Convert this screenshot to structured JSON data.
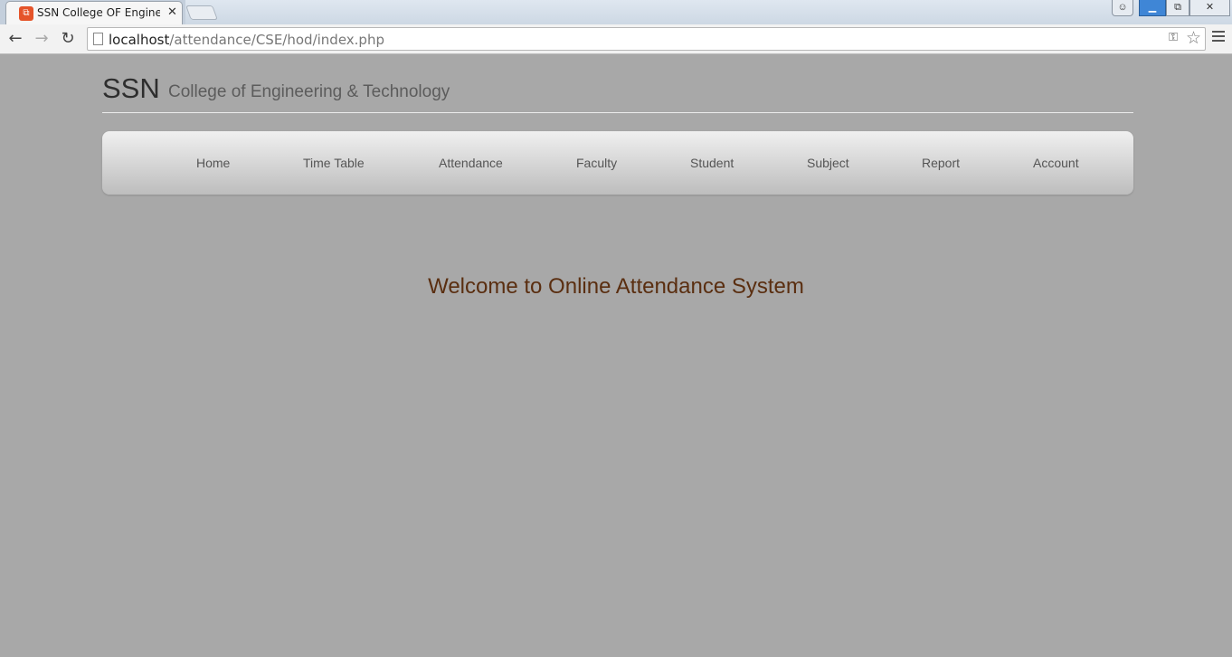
{
  "browser": {
    "tab_title": "SSN College OF Engineering",
    "tab_favicon_glyph": "⧉",
    "url_host": "localhost",
    "url_path": "/attendance/CSE/hod/index.php",
    "icons": {
      "back": "←",
      "forward": "→",
      "reload": "↻",
      "close_tab": "✕",
      "star": "☆",
      "key": "⚿",
      "user": "☺",
      "minimize": "▁",
      "maximize": "⧉",
      "close_window": "✕"
    }
  },
  "site": {
    "brand": "SSN",
    "subtitle": "College of Engineering & Technology"
  },
  "nav": {
    "items": [
      {
        "label": "Home"
      },
      {
        "label": "Time Table"
      },
      {
        "label": "Attendance"
      },
      {
        "label": "Faculty"
      },
      {
        "label": "Student"
      },
      {
        "label": "Subject"
      },
      {
        "label": "Report"
      },
      {
        "label": "Account"
      }
    ]
  },
  "main": {
    "welcome": "Welcome to Online Attendance System"
  },
  "colors": {
    "page_background": "#a8a8a8",
    "welcome_text": "#5a2e10"
  }
}
